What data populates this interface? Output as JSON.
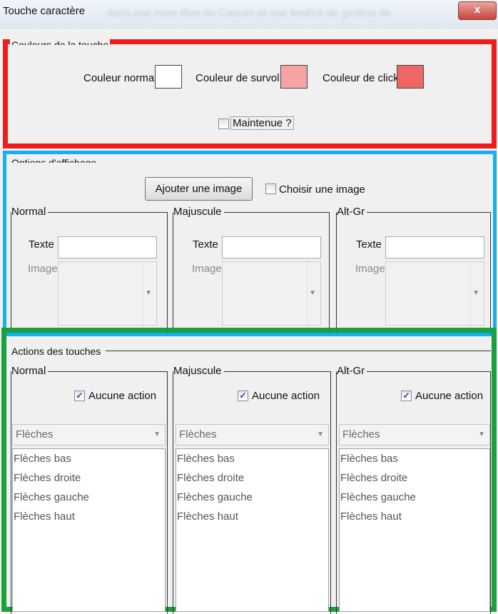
{
  "window": {
    "title": "Touche caractère",
    "ghost_text": "dans une zone libre du Canvas et une fenêtre de gestion de",
    "close_glyph": "x"
  },
  "colors_section": {
    "legend": "Couleurs de la touche",
    "normal_label": "Couleur normal",
    "hover_label": "Couleur de survol",
    "click_label": "Couleur de click",
    "normal_color": "#ffffff",
    "hover_color": "#f7a3a3",
    "click_color": "#ee6666",
    "maintain_label": "Maintenue ?",
    "maintain_checked": false
  },
  "display_section": {
    "legend": "Options d'affichage",
    "add_image_button": "Ajouter une image",
    "choose_image_label": "Choisir une image",
    "choose_image_checked": false,
    "groups": [
      {
        "title": "Normal",
        "text_label": "Texte",
        "text_value": "",
        "image_label": "Image"
      },
      {
        "title": "Majuscule",
        "text_label": "Texte",
        "text_value": "",
        "image_label": "Image"
      },
      {
        "title": "Alt-Gr",
        "text_label": "Texte",
        "text_value": "",
        "image_label": "Image"
      }
    ]
  },
  "actions_section": {
    "legend": "Actions des touches",
    "groups": [
      {
        "title": "Normal",
        "no_action_label": "Aucune action",
        "no_action_checked": true,
        "combo_value": "Flèches",
        "items": [
          "Flèches bas",
          "Flèches droite",
          "Flèches gauche",
          "Flèches haut"
        ]
      },
      {
        "title": "Majuscule",
        "no_action_label": "Aucune action",
        "no_action_checked": true,
        "combo_value": "Flèches",
        "items": [
          "Flèches bas",
          "Flèches droite",
          "Flèches gauche",
          "Flèches haut"
        ]
      },
      {
        "title": "Alt-Gr",
        "no_action_label": "Aucune action",
        "no_action_checked": true,
        "combo_value": "Flèches",
        "items": [
          "Flèches bas",
          "Flèches droite",
          "Flèches gauche",
          "Flèches haut"
        ]
      }
    ]
  },
  "highlight_colors": {
    "red": "#ee1c1c",
    "blue": "#16b0f0",
    "green": "#1aa13c"
  }
}
